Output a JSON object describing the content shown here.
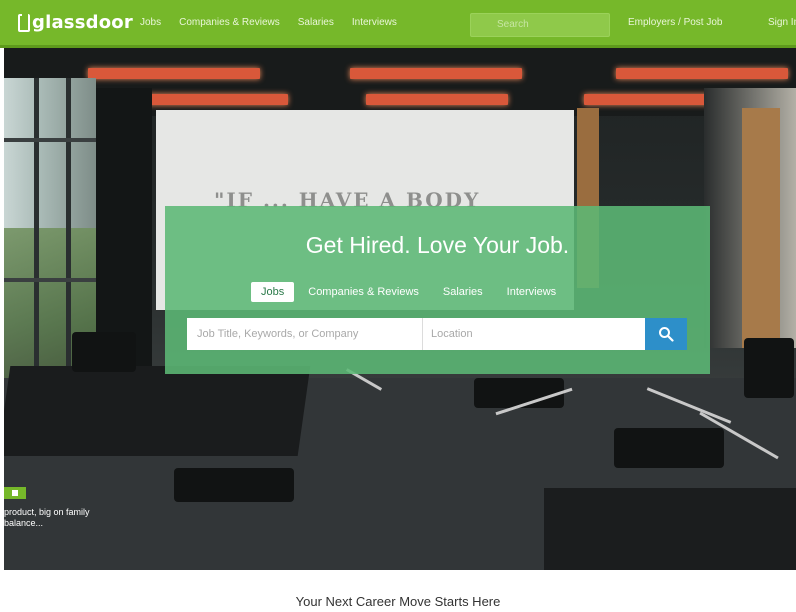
{
  "nav": {
    "logo": "glassdoor",
    "links": [
      "Jobs",
      "Companies & Reviews",
      "Salaries",
      "Interviews"
    ],
    "search_placeholder": "Search",
    "employers": "Employers / Post Job",
    "signin": "Sign In"
  },
  "hero": {
    "wall_text": "\"IF ... HAVE A BODY",
    "side_card_text": "product, big on family balance..."
  },
  "search_card": {
    "title": "Get Hired. Love Your Job.",
    "tabs": [
      "Jobs",
      "Companies & Reviews",
      "Salaries",
      "Interviews"
    ],
    "active_tab": "Jobs",
    "job_placeholder": "Job Title, Keywords, or Company",
    "location_placeholder": "Location",
    "search_icon": "search-icon"
  },
  "tagline": "Your Next Career Move Starts Here",
  "colors": {
    "brand_green": "#76b82a",
    "card_green": "#5cb875",
    "search_blue": "#2d8fc9"
  }
}
